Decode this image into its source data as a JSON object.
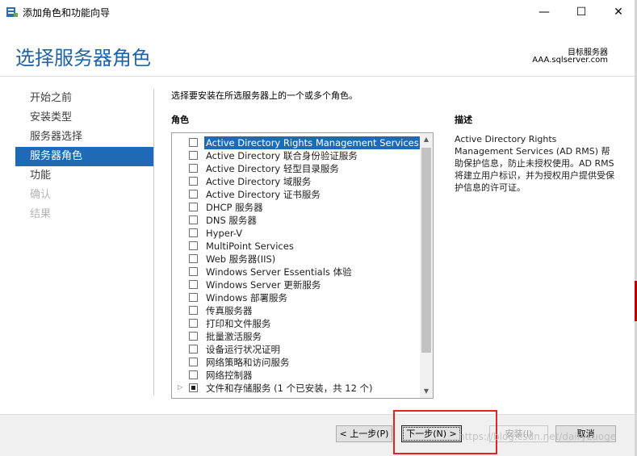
{
  "window": {
    "title": "添加角色和功能向导",
    "controls": {
      "minimize": "—",
      "maximize": "☐",
      "close": "✕"
    }
  },
  "header": {
    "page_title": "选择服务器角色",
    "target_label": "目标服务器",
    "target_server": "AAA.sqlserver.com"
  },
  "nav": {
    "items": [
      {
        "label": "开始之前",
        "state": "normal"
      },
      {
        "label": "安装类型",
        "state": "normal"
      },
      {
        "label": "服务器选择",
        "state": "normal"
      },
      {
        "label": "服务器角色",
        "state": "active"
      },
      {
        "label": "功能",
        "state": "normal"
      },
      {
        "label": "确认",
        "state": "disabled"
      },
      {
        "label": "结果",
        "state": "disabled"
      }
    ]
  },
  "main": {
    "instruction": "选择要安装在所选服务器上的一个或多个角色。",
    "roles_header": "角色",
    "description_header": "描述",
    "description_text": "Active Directory Rights Management Services (AD RMS) 帮助保护信息，防止未授权使用。AD RMS 将建立用户标识，并为授权用户提供受保护信息的许可证。",
    "roles": [
      {
        "label": "Active Directory Rights Management Services",
        "checked": false,
        "selected": true
      },
      {
        "label": "Active Directory 联合身份验证服务",
        "checked": false
      },
      {
        "label": "Active Directory 轻型目录服务",
        "checked": false
      },
      {
        "label": "Active Directory 域服务",
        "checked": false
      },
      {
        "label": "Active Directory 证书服务",
        "checked": false
      },
      {
        "label": "DHCP 服务器",
        "checked": false
      },
      {
        "label": "DNS 服务器",
        "checked": false
      },
      {
        "label": "Hyper-V",
        "checked": false
      },
      {
        "label": "MultiPoint Services",
        "checked": false
      },
      {
        "label": "Web 服务器(IIS)",
        "checked": false
      },
      {
        "label": "Windows Server Essentials 体验",
        "checked": false
      },
      {
        "label": "Windows Server 更新服务",
        "checked": false
      },
      {
        "label": "Windows 部署服务",
        "checked": false
      },
      {
        "label": "传真服务器",
        "checked": false
      },
      {
        "label": "打印和文件服务",
        "checked": false
      },
      {
        "label": "批量激活服务",
        "checked": false
      },
      {
        "label": "设备运行状况证明",
        "checked": false
      },
      {
        "label": "网络策略和访问服务",
        "checked": false
      },
      {
        "label": "网络控制器",
        "checked": false
      },
      {
        "label": "文件和存储服务 (1 个已安装，共 12 个)",
        "checked": "partial",
        "expandable": true
      }
    ]
  },
  "footer": {
    "back_label": "< 上一步(P)",
    "next_label": "下一步(N) >",
    "install_label": "安装(I)",
    "cancel_label": "取消"
  },
  "watermark": "https://blog.csdn.net/dairyLuoge",
  "colors": {
    "accent": "#1e6ab6",
    "title": "#1f63a8",
    "highlight": "#e8231b"
  }
}
